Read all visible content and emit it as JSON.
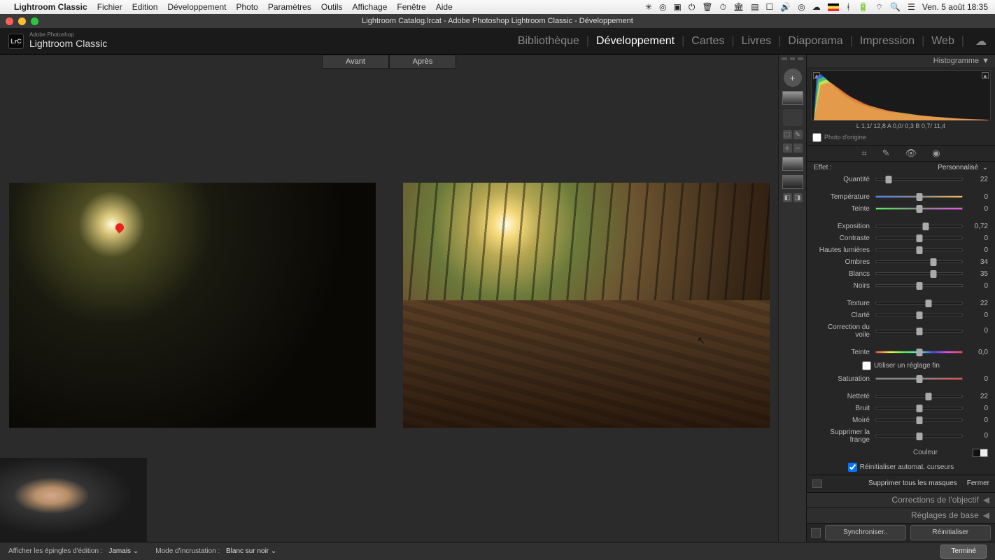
{
  "menubar": {
    "app": "Lightroom Classic",
    "items": [
      "Fichier",
      "Edition",
      "Développement",
      "Photo",
      "Paramètres",
      "Outils",
      "Affichage",
      "Fenêtre",
      "Aide"
    ],
    "clock": "Ven. 5 août  18:35"
  },
  "window_title": "Lightroom Catalog.lrcat - Adobe Photoshop Lightroom Classic - Développement",
  "brand": {
    "small": "Adobe Photoshop",
    "big": "Lightroom Classic",
    "logo": "LrC"
  },
  "modules": [
    "Bibliothèque",
    "Développement",
    "Cartes",
    "Livres",
    "Diaporama",
    "Impression",
    "Web"
  ],
  "modules_active": "Développement",
  "compare": {
    "before": "Avant",
    "after": "Après"
  },
  "right": {
    "histogram_title": "Histogramme",
    "histogram_readout": "L      1,1/  12,8  A     0,0/   0,3  B     0,7/  11,4",
    "origin_label": "Photo d'origine",
    "effect_label": "Effet :",
    "effect_value": "Personnalisé",
    "sliders": [
      {
        "label": "Quantité",
        "value": "22",
        "pos": 15,
        "type": ""
      },
      {
        "gap": true
      },
      {
        "label": "Température",
        "value": "0",
        "pos": 50,
        "type": "temp"
      },
      {
        "label": "Teinte",
        "value": "0",
        "pos": 50,
        "type": "tint"
      },
      {
        "gap": true
      },
      {
        "label": "Exposition",
        "value": "0,72",
        "pos": 58,
        "type": ""
      },
      {
        "label": "Contraste",
        "value": "0",
        "pos": 50,
        "type": ""
      },
      {
        "label": "Hautes lumières",
        "value": "0",
        "pos": 50,
        "type": ""
      },
      {
        "label": "Ombres",
        "value": "34",
        "pos": 67,
        "type": ""
      },
      {
        "label": "Blancs",
        "value": "35",
        "pos": 67,
        "type": ""
      },
      {
        "label": "Noirs",
        "value": "0",
        "pos": 50,
        "type": ""
      },
      {
        "gap": true
      },
      {
        "label": "Texture",
        "value": "22",
        "pos": 61,
        "type": ""
      },
      {
        "label": "Clarté",
        "value": "0",
        "pos": 50,
        "type": ""
      },
      {
        "label": "Correction du voile",
        "value": "0",
        "pos": 50,
        "type": ""
      },
      {
        "gap": true
      },
      {
        "label": "Teinte",
        "value": "0,0",
        "pos": 50,
        "type": "hue"
      }
    ],
    "fine_tune": "Utiliser un réglage fin",
    "sliders2": [
      {
        "label": "Saturation",
        "value": "0",
        "pos": 50,
        "type": "sat"
      },
      {
        "gap": true
      },
      {
        "label": "Netteté",
        "value": "22",
        "pos": 61,
        "type": ""
      },
      {
        "label": "Bruit",
        "value": "0",
        "pos": 50,
        "type": ""
      },
      {
        "label": "Moiré",
        "value": "0",
        "pos": 50,
        "type": ""
      },
      {
        "label": "Supprimer la frange",
        "value": "0",
        "pos": 50,
        "type": ""
      }
    ],
    "color_label": "Couleur",
    "auto_reset": "Réinitialiser automat. curseurs",
    "delete_masks": "Supprimer tous les masques",
    "close": "Fermer",
    "collapsed": [
      "Corrections de l'objectif",
      "Réglages de base"
    ],
    "sync": "Synchroniser..",
    "reset": "Réinitialiser"
  },
  "bottom": {
    "pins_label": "Afficher les épingles d'édition :",
    "pins_value": "Jamais",
    "overlay_label": "Mode d'incrustation :",
    "overlay_value": "Blanc sur noir",
    "done": "Terminé"
  }
}
